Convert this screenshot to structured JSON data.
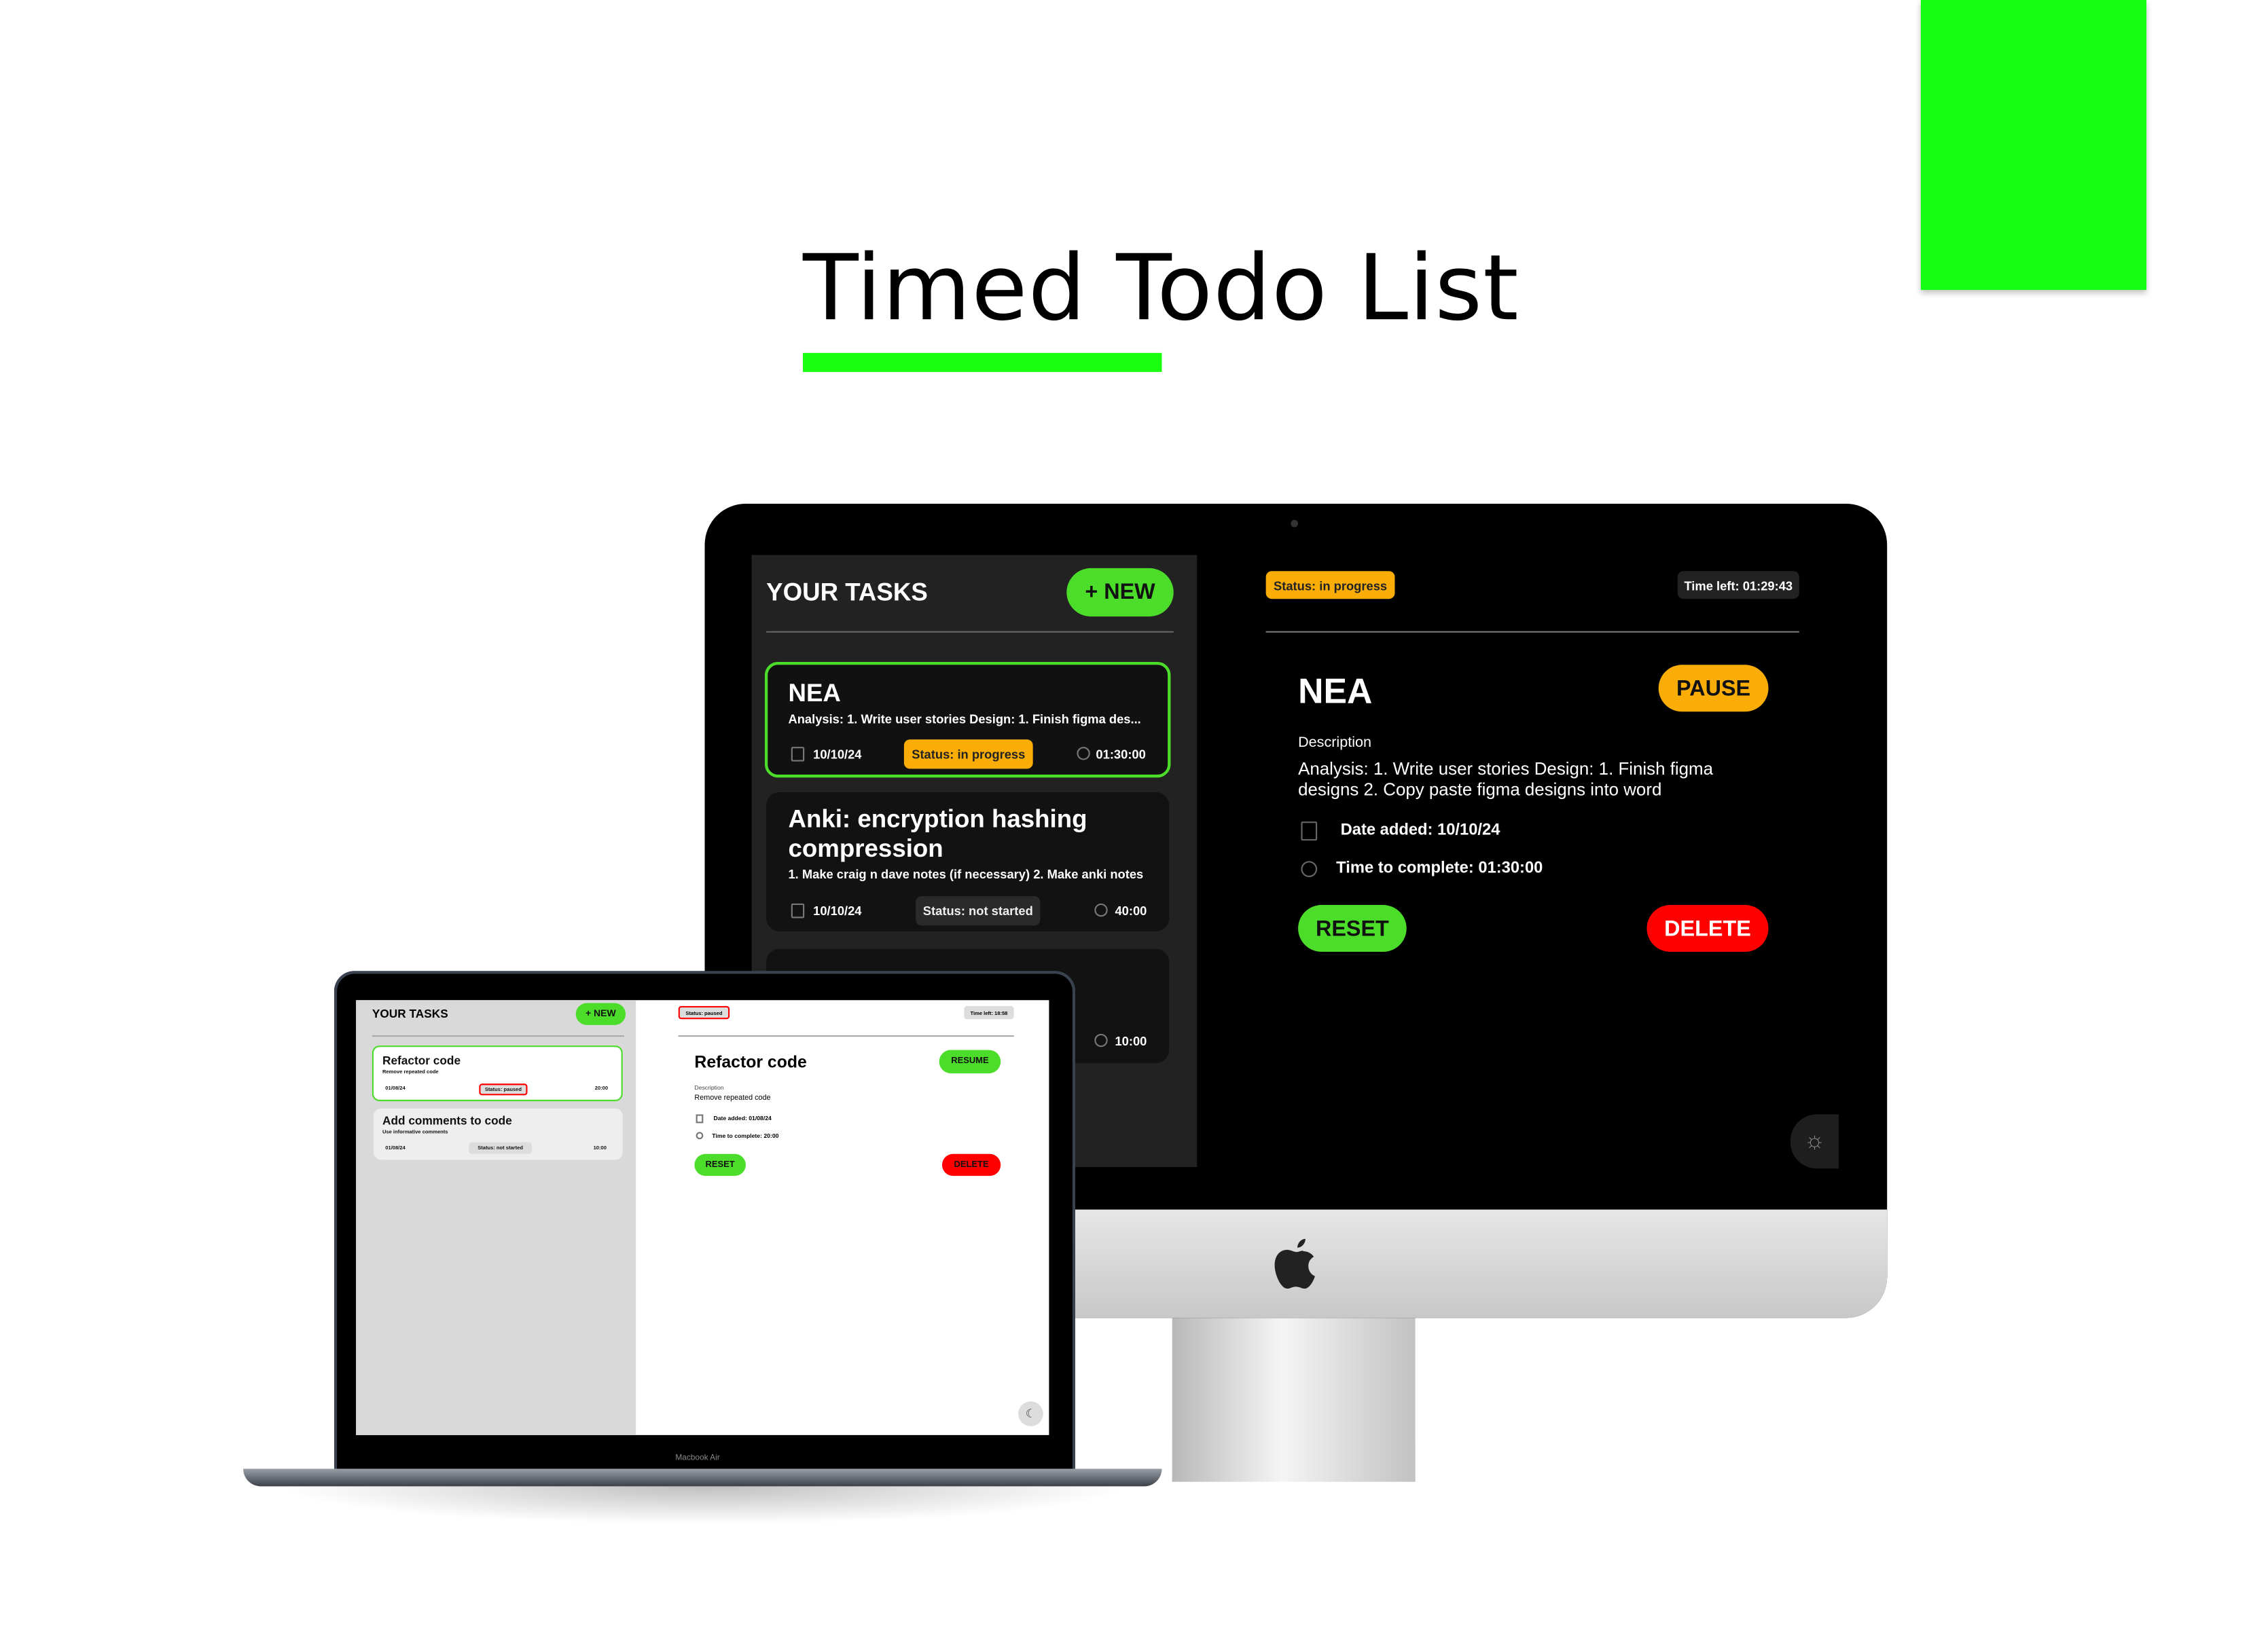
{
  "hero": {
    "title": "Timed Todo List",
    "accent_color": "#14ff13"
  },
  "imac": {
    "sidebar": {
      "heading": "YOUR TASKS",
      "new_button": "+ NEW",
      "tasks": [
        {
          "title": "NEA",
          "description": "Analysis: 1. Write user stories Design: 1. Finish figma des...",
          "date": "10/10/24",
          "status": "Status: in progress",
          "duration": "01:30:00",
          "selected": true
        },
        {
          "title": "Anki: encryption hashing compression",
          "description": "1. Make craig n dave notes (if necessary) 2. Make anki notes",
          "date": "10/10/24",
          "status": "Status: not started",
          "duration": "40:00"
        },
        {
          "duration": "10:00"
        }
      ]
    },
    "detail": {
      "status": "Status: in progress",
      "time_left": "Time left: 01:29:43",
      "title": "NEA",
      "pause_button": "PAUSE",
      "description_label": "Description",
      "description": "Analysis: 1. Write user stories Design: 1. Finish figma designs 2. Copy paste figma designs into word",
      "date_added": "Date added: 10/10/24",
      "time_to_complete": "Time to complete: 01:30:00",
      "reset_button": "RESET",
      "delete_button": "DELETE"
    },
    "theme_toggle_icon": "sun-icon"
  },
  "laptop": {
    "label": "Macbook Air",
    "sidebar": {
      "heading": "YOUR TASKS",
      "new_button": "+ NEW",
      "tasks": [
        {
          "title": "Refactor code",
          "description": "Remove repeated code",
          "date": "01/08/24",
          "status": "Status: paused",
          "duration": "20:00",
          "selected": true
        },
        {
          "title": "Add comments to code",
          "description": "Use informative comments",
          "date": "01/08/24",
          "status": "Status: not started",
          "duration": "10:00"
        }
      ]
    },
    "detail": {
      "status": "Status: paused",
      "time_left": "Time left: 18:58",
      "title": "Refactor code",
      "resume_button": "RESUME",
      "description_label": "Description",
      "description": "Remove repeated code",
      "date_added": "Date added: 01/08/24",
      "time_to_complete": "Time to complete: 20:00",
      "reset_button": "RESET",
      "delete_button": "DELETE"
    },
    "theme_toggle_icon": "moon-icon"
  },
  "colors": {
    "green": "#4cdc2a",
    "orange": "#f9ad06",
    "red": "#ff0000"
  }
}
